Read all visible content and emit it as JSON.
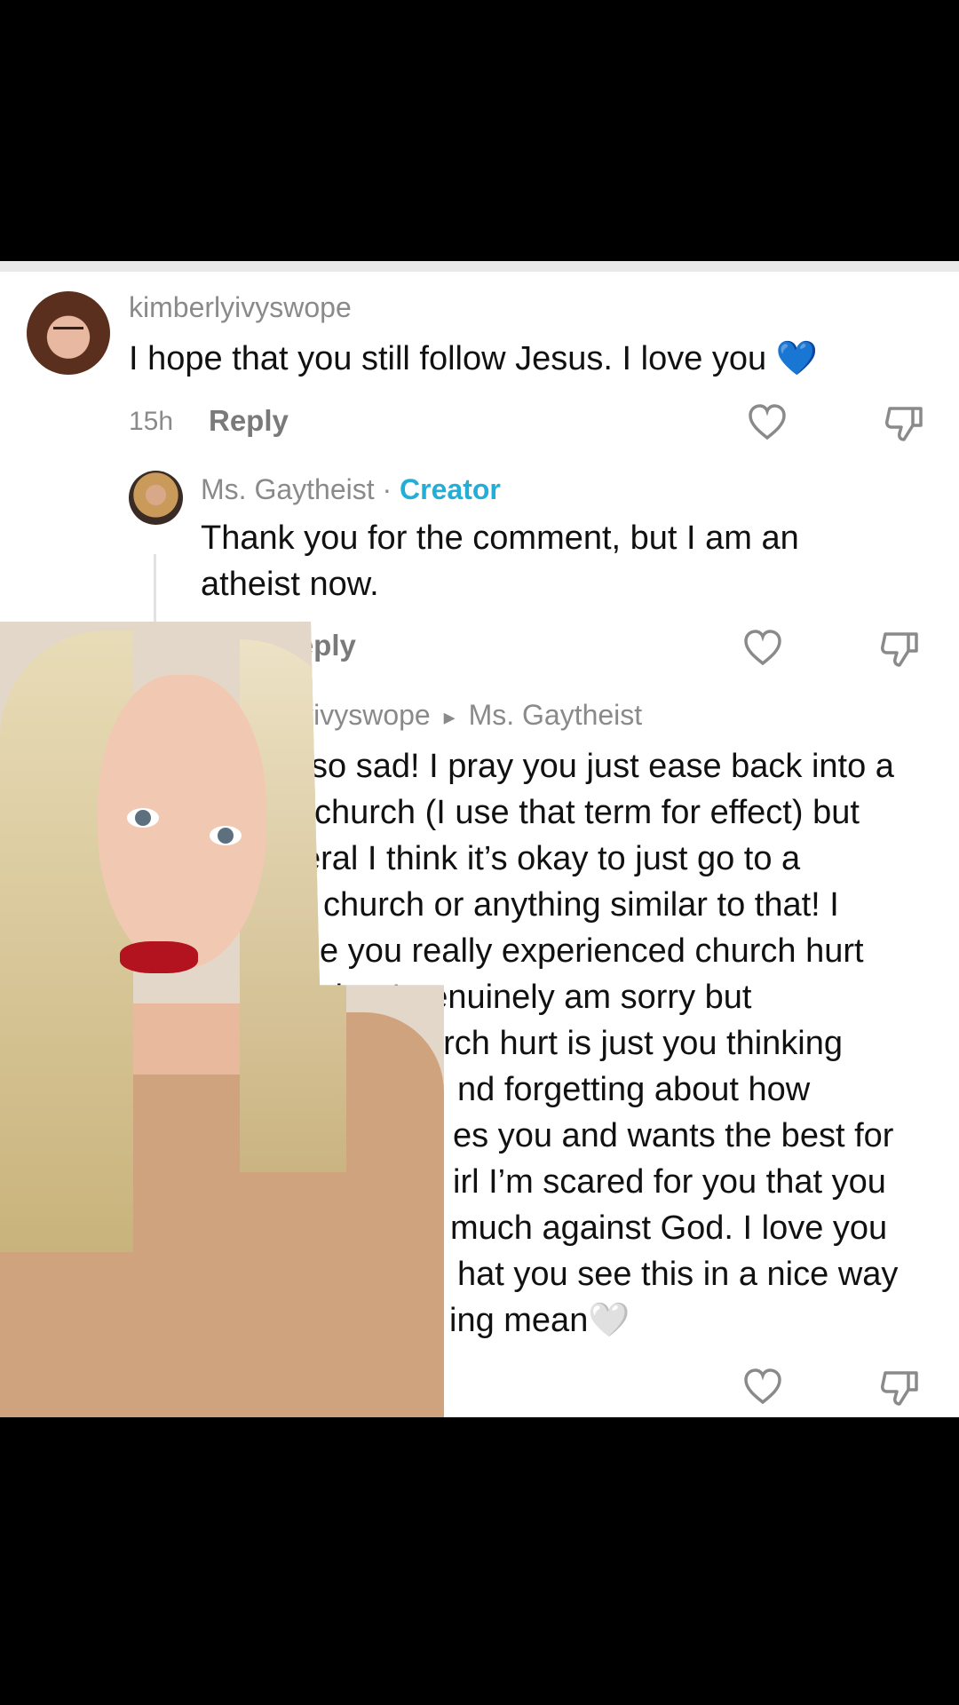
{
  "comment1": {
    "username": "kimberlyivyswope",
    "text": "I hope that you still follow Jesus. I love you 💙",
    "time": "15h",
    "reply_label": "Reply"
  },
  "reply1": {
    "username": "Ms. Gaytheist",
    "separator": "·",
    "badge": "Creator",
    "text_line1": "Thank you for the comment, but I am an",
    "text_line2": "atheist now.",
    "reply_label": "Reply"
  },
  "reply2": {
    "username_visible": "lyivyswope",
    "arrow": "▸",
    "reply_to": "Ms. Gaytheist",
    "lines": [
      "so sad! I pray you just ease back into a",
      "church (I use that term for effect) but",
      "eral I think it’s okay to just go to a",
      "church or anything similar to that! I",
      "e you really experienced church hurt",
      "that I genuinely am sorry but",
      "urch hurt is just you thinking",
      "nd forgetting about how",
      "es you and wants the best for",
      "irl I’m scared for you that you",
      "much against God. I love you",
      "hat you see this in a nice way",
      "ing mean🤍"
    ]
  },
  "icons": {
    "like": "heart-icon",
    "dislike": "thumbs-down-icon"
  }
}
